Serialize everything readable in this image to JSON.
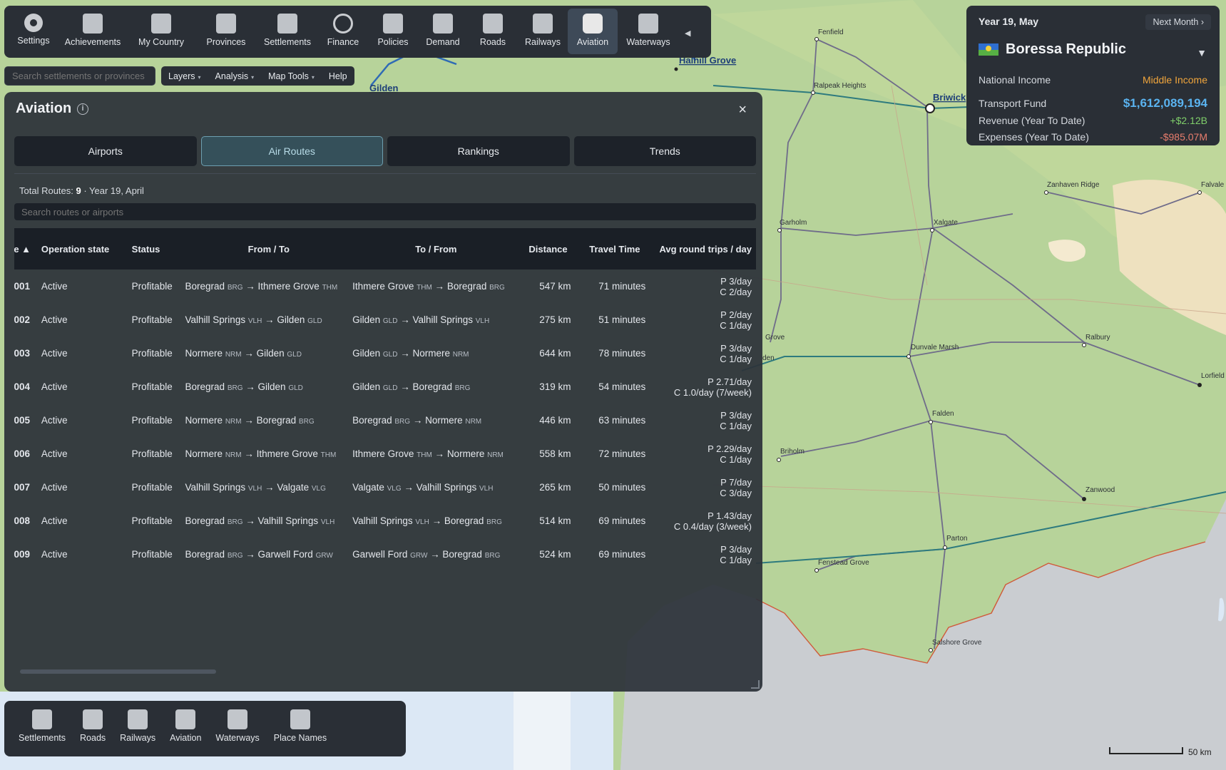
{
  "toolbar": {
    "items": [
      {
        "label": "Settings",
        "icon": "gear-icon"
      },
      {
        "label": "Achievements",
        "icon": "trophy-icon"
      },
      {
        "label": "My Country",
        "icon": "country-icon"
      },
      {
        "label": "Provinces",
        "icon": "provinces-icon"
      },
      {
        "label": "Settlements",
        "icon": "settlements-icon"
      },
      {
        "label": "Finance",
        "icon": "finance-icon"
      },
      {
        "label": "Policies",
        "icon": "policies-icon"
      },
      {
        "label": "Demand",
        "icon": "demand-icon"
      },
      {
        "label": "Roads",
        "icon": "roads-icon"
      },
      {
        "label": "Railways",
        "icon": "railways-icon"
      },
      {
        "label": "Aviation",
        "icon": "aviation-icon"
      },
      {
        "label": "Waterways",
        "icon": "waterways-icon"
      }
    ],
    "active": "Aviation",
    "collapse": "◀"
  },
  "search": {
    "placeholder": "Search settlements or provinces"
  },
  "menu": {
    "layers": "Layers",
    "analysis": "Analysis",
    "map_tools": "Map Tools",
    "help": "Help",
    "caret": "▾"
  },
  "panel": {
    "title": "Aviation",
    "info": "i",
    "close": "×",
    "tabs": [
      "Airports",
      "Air Routes",
      "Rankings",
      "Trends"
    ],
    "summary_prefix": "Total Routes:",
    "summary_count": "9",
    "summary_suffix": " · Year 19, April",
    "route_search_placeholder": "Search routes or airports",
    "columns": [
      "te ▲",
      "Operation state",
      "Status",
      "From / To",
      "To / From",
      "Distance",
      "Travel Time",
      "Avg round trips / day"
    ],
    "rows": [
      {
        "id": "·001",
        "op": "Active",
        "status": "Profitable",
        "from_a": "Boregrad",
        "from_a_code": "BRG",
        "from_b": "Ithmere Grove",
        "from_b_code": "THM",
        "to_a": "Ithmere Grove",
        "to_a_code": "THM",
        "to_b": "Boregrad",
        "to_b_code": "BRG",
        "distance": "547 km",
        "time": "71 minutes",
        "avg_p": "P 3/day",
        "avg_c": "C 2/day"
      },
      {
        "id": "·002",
        "op": "Active",
        "status": "Profitable",
        "from_a": "Valhill Springs",
        "from_a_code": "VLH",
        "from_b": "Gilden",
        "from_b_code": "GLD",
        "to_a": "Gilden",
        "to_a_code": "GLD",
        "to_b": "Valhill Springs",
        "to_b_code": "VLH",
        "distance": "275 km",
        "time": "51 minutes",
        "avg_p": "P 2/day",
        "avg_c": "C 1/day"
      },
      {
        "id": "·003",
        "op": "Active",
        "status": "Profitable",
        "from_a": "Normere",
        "from_a_code": "NRM",
        "from_b": "Gilden",
        "from_b_code": "GLD",
        "to_a": "Gilden",
        "to_a_code": "GLD",
        "to_b": "Normere",
        "to_b_code": "NRM",
        "distance": "644 km",
        "time": "78 minutes",
        "avg_p": "P 3/day",
        "avg_c": "C 1/day"
      },
      {
        "id": "·004",
        "op": "Active",
        "status": "Profitable",
        "from_a": "Boregrad",
        "from_a_code": "BRG",
        "from_b": "Gilden",
        "from_b_code": "GLD",
        "to_a": "Gilden",
        "to_a_code": "GLD",
        "to_b": "Boregrad",
        "to_b_code": "BRG",
        "distance": "319 km",
        "time": "54 minutes",
        "avg_p": "P 2.71/day",
        "avg_c": "C 1.0/day (7/week)"
      },
      {
        "id": "·005",
        "op": "Active",
        "status": "Profitable",
        "from_a": "Normere",
        "from_a_code": "NRM",
        "from_b": "Boregrad",
        "from_b_code": "BRG",
        "to_a": "Boregrad",
        "to_a_code": "BRG",
        "to_b": "Normere",
        "to_b_code": "NRM",
        "distance": "446 km",
        "time": "63 minutes",
        "avg_p": "P 3/day",
        "avg_c": "C 1/day"
      },
      {
        "id": "·006",
        "op": "Active",
        "status": "Profitable",
        "from_a": "Normere",
        "from_a_code": "NRM",
        "from_b": "Ithmere Grove",
        "from_b_code": "THM",
        "to_a": "Ithmere Grove",
        "to_a_code": "THM",
        "to_b": "Normere",
        "to_b_code": "NRM",
        "distance": "558 km",
        "time": "72 minutes",
        "avg_p": "P 2.29/day",
        "avg_c": "C 1/day"
      },
      {
        "id": "·007",
        "op": "Active",
        "status": "Profitable",
        "from_a": "Valhill Springs",
        "from_a_code": "VLH",
        "from_b": "Valgate",
        "from_b_code": "VLG",
        "to_a": "Valgate",
        "to_a_code": "VLG",
        "to_b": "Valhill Springs",
        "to_b_code": "VLH",
        "distance": "265 km",
        "time": "50 minutes",
        "avg_p": "P 7/day",
        "avg_c": "C 3/day"
      },
      {
        "id": "·008",
        "op": "Active",
        "status": "Profitable",
        "from_a": "Boregrad",
        "from_a_code": "BRG",
        "from_b": "Valhill Springs",
        "from_b_code": "VLH",
        "to_a": "Valhill Springs",
        "to_a_code": "VLH",
        "to_b": "Boregrad",
        "to_b_code": "BRG",
        "distance": "514 km",
        "time": "69 minutes",
        "avg_p": "P 1.43/day",
        "avg_c": "C 0.4/day (3/week)"
      },
      {
        "id": "·009",
        "op": "Active",
        "status": "Profitable",
        "from_a": "Boregrad",
        "from_a_code": "BRG",
        "from_b": "Garwell Ford",
        "from_b_code": "GRW",
        "to_a": "Garwell Ford",
        "to_a_code": "GRW",
        "to_b": "Boregrad",
        "to_b_code": "BRG",
        "distance": "524 km",
        "time": "69 minutes",
        "avg_p": "P 3/day",
        "avg_c": "C 1/day"
      }
    ]
  },
  "nation": {
    "date": "Year 19, May",
    "next_month": "Next Month ›",
    "name": "Boressa Republic",
    "caret": "▼",
    "national_income_label": "National Income",
    "national_income_value": "Middle Income",
    "transport_fund_label": "Transport Fund",
    "transport_fund_value": "$1,612,089,194",
    "revenue_label": "Revenue (Year To Date)",
    "revenue_value": "+$2.12B",
    "expenses_label": "Expenses (Year To Date)",
    "expenses_value": "-$985.07M",
    "colors": {
      "income": "#f0a53c",
      "fund": "#5ab3f0",
      "revenue": "#7fce6a",
      "expenses": "#e87d6d"
    }
  },
  "bottombar": {
    "items": [
      {
        "label": "Settlements",
        "icon": "settlements-icon"
      },
      {
        "label": "Roads",
        "icon": "roads-icon"
      },
      {
        "label": "Railways",
        "icon": "railways-icon"
      },
      {
        "label": "Aviation",
        "icon": "plane-icon"
      },
      {
        "label": "Waterways",
        "icon": "waterways-icon"
      },
      {
        "label": "Place Names",
        "icon": "place-names-icon"
      }
    ]
  },
  "map": {
    "labels": {
      "halhill": "Halhill Grove",
      "gilden": "Gilden",
      "fenfield": "Fenfield",
      "ralpeak": "Ralpeak Heights",
      "briwick": "Briwick",
      "zanhaven": "Zanhaven Ridge",
      "falvale": "Falvale",
      "garholm": "Garholm",
      "xalgate": "Xalgate",
      "grove": "Grove",
      "dunvale": "Dunvale Marsh",
      "ralbury": "Ralbury",
      "lorfield": "Lorfield",
      "falden": "Falden",
      "briholm": "Briholm",
      "zanwood": "Zanwood",
      "parton": "Parton",
      "fenstead": "Fenstead Grove",
      "salshore": "Salshore Grove",
      "den": "den"
    },
    "scale_label": "50 km"
  }
}
